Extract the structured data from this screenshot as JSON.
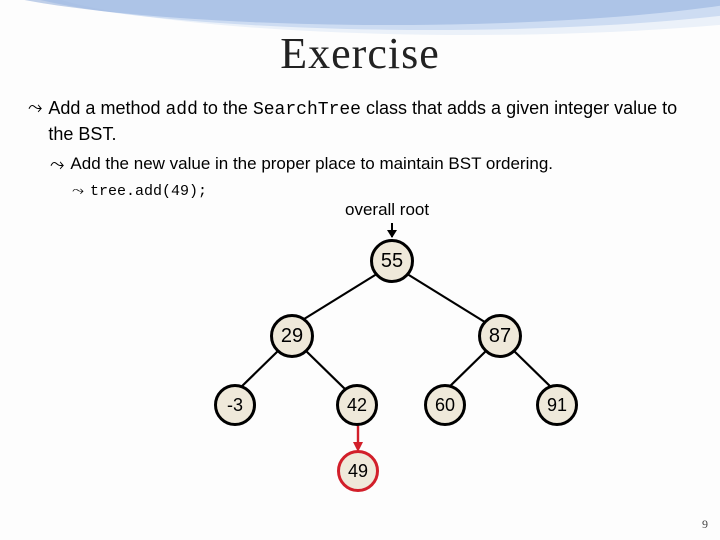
{
  "title": "Exercise",
  "bullets": {
    "main": {
      "pre": "Add a method ",
      "code1": "add",
      "mid": " to the ",
      "code2": "SearchTree",
      "post": " class that adds a given integer value to the BST."
    },
    "sub": "Add the new value in the proper place to maintain BST ordering.",
    "subsub": "tree.add(49);"
  },
  "overall_root_label": "overall root",
  "tree": {
    "root": "55",
    "l": "29",
    "r": "87",
    "ll": "-3",
    "lr": "42",
    "rl": "60",
    "rr": "91",
    "inserted": "49"
  },
  "page_number": "9"
}
